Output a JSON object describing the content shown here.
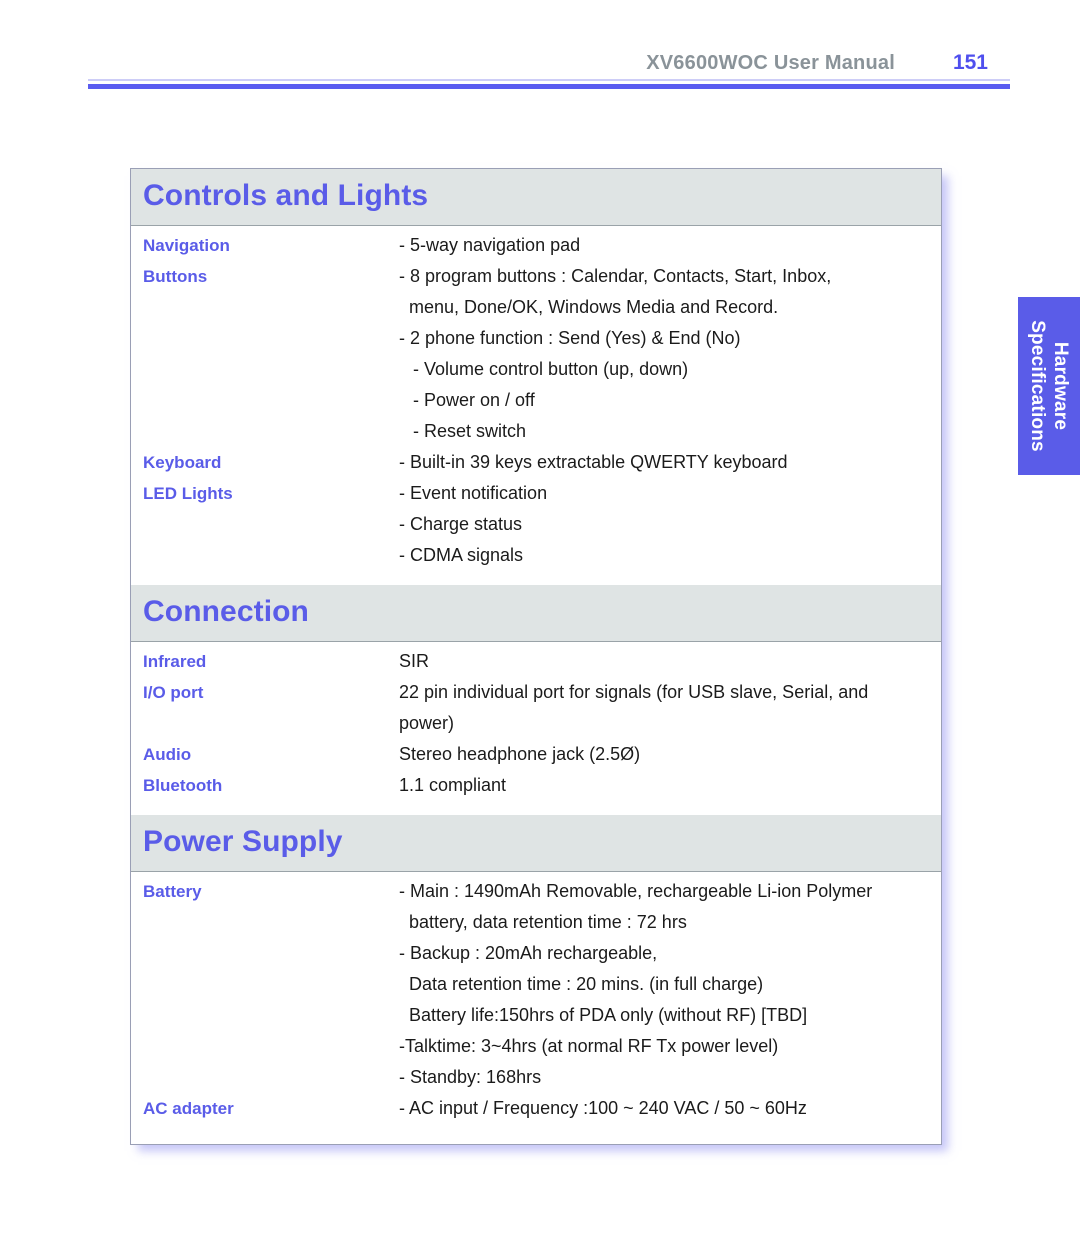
{
  "header": {
    "manual_title": "XV6600WOC User Manual",
    "page_number": "151"
  },
  "side_tab": {
    "label": "Hardware\nSpecifications",
    "background_color": "#5a5ce8",
    "text_color": "#ffffff"
  },
  "colors": {
    "accent_blue": "#5a5ce8",
    "section_header_bg": "#dfe4e4",
    "header_gray": "#8a9399",
    "body_text": "#1b1b1b",
    "table_border": "#9a9fb5",
    "shadow_lavender": "#9696f0"
  },
  "sections": [
    {
      "title": "Controls and Lights",
      "rows": [
        {
          "label": "Navigation",
          "lines": [
            {
              "text": "- 5-way navigation pad",
              "style": "normal"
            }
          ]
        },
        {
          "label": "Buttons",
          "lines": [
            {
              "text": "- 8 program buttons : Calendar, Contacts, Start, Inbox,",
              "style": "normal"
            },
            {
              "text": "menu, Done/OK, Windows Media and Record.",
              "style": "cont"
            },
            {
              "text": "- 2 phone function : Send (Yes) & End (No)",
              "style": "normal"
            }
          ]
        },
        {
          "label": "",
          "lines": [
            {
              "text": "- Volume control button (up, down)",
              "style": "indent2"
            },
            {
              "text": "- Power on / off",
              "style": "indent2"
            },
            {
              "text": "- Reset switch",
              "style": "indent2"
            }
          ]
        },
        {
          "label": "Keyboard",
          "lines": [
            {
              "text": "- Built-in 39 keys extractable QWERTY keyboard",
              "style": "normal"
            }
          ]
        },
        {
          "label": "LED Lights",
          "lines": [
            {
              "text": "- Event notification",
              "style": "normal"
            },
            {
              "text": "- Charge status",
              "style": "normal"
            },
            {
              "text": "- CDMA signals",
              "style": "normal"
            }
          ]
        }
      ]
    },
    {
      "title": "Connection",
      "rows": [
        {
          "label": "Infrared",
          "lines": [
            {
              "text": "SIR",
              "style": "normal"
            }
          ]
        },
        {
          "label": "I/O port",
          "lines": [
            {
              "text": "22 pin individual port for signals (for USB slave, Serial, and",
              "style": "normal"
            },
            {
              "text": "power)",
              "style": "normal"
            }
          ]
        },
        {
          "label": "Audio",
          "lines": [
            {
              "text": "Stereo headphone jack (2.5Ø)",
              "style": "normal"
            }
          ]
        },
        {
          "label": "Bluetooth",
          "lines": [
            {
              "text": "1.1 compliant",
              "style": "normal"
            }
          ]
        }
      ]
    },
    {
      "title": "Power Supply",
      "rows": [
        {
          "label": "Battery",
          "lines": [
            {
              "text": "- Main : 1490mAh Removable, rechargeable Li-ion Polymer",
              "style": "normal"
            },
            {
              "text": "battery, data retention time : 72 hrs",
              "style": "cont"
            },
            {
              "text": "- Backup : 20mAh rechargeable,",
              "style": "normal"
            },
            {
              "text": "Data retention time : 20 mins. (in full charge)",
              "style": "cont"
            },
            {
              "text": "Battery life:150hrs of PDA only (without RF) [TBD]",
              "style": "cont"
            },
            {
              "text": "-Talktime: 3~4hrs (at normal RF Tx power level)",
              "style": "normal"
            },
            {
              "text": "- Standby: 168hrs",
              "style": "normal"
            }
          ]
        },
        {
          "label": "AC adapter",
          "lines": [
            {
              "text": "- AC input / Frequency :100 ~ 240 VAC / 50 ~ 60Hz",
              "style": "normal"
            }
          ]
        }
      ]
    }
  ]
}
